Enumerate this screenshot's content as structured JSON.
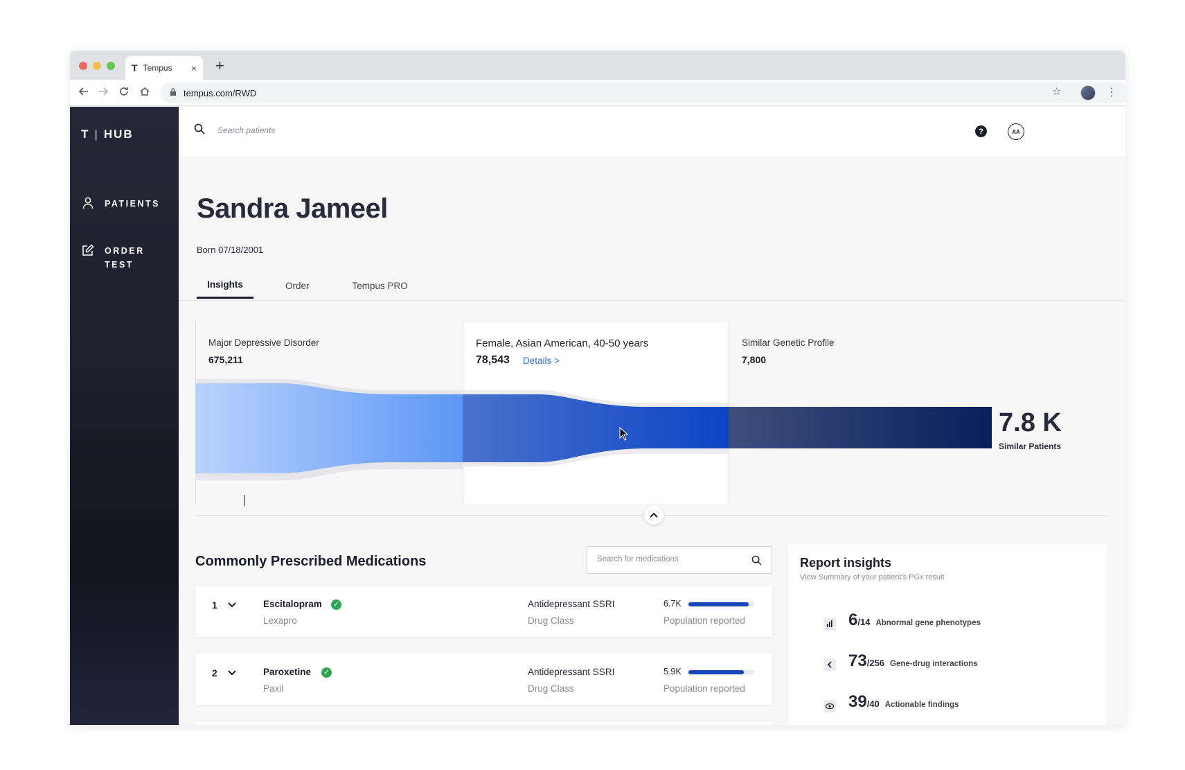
{
  "browser": {
    "tab_title": "Tempus",
    "tab_favicon": "T",
    "tab_close": "×",
    "new_tab": "+",
    "url": "tempus.com/RWD",
    "nav_icons": [
      "back-arrow-icon",
      "forward-arrow-icon",
      "reload-icon",
      "home-icon"
    ]
  },
  "sidebar": {
    "logo_left": "T",
    "logo_sep": "|",
    "logo_right": "HUB",
    "items": [
      {
        "label": "PATIENTS",
        "icon": "user-icon"
      },
      {
        "label_line1": "ORDER",
        "label_line2": "TEST",
        "icon": "edit-icon"
      }
    ]
  },
  "topbar": {
    "search_placeholder": "Search patients",
    "help": "?",
    "user_initials": "AA"
  },
  "patient": {
    "name": "Sandra Jameel",
    "born_label": "Born",
    "born_date": "07/18/2001"
  },
  "tabs": [
    "Insights",
    "Order",
    "Tempus PRO"
  ],
  "funnel": {
    "stages": [
      {
        "label": "Major Depressive Disorder",
        "value": "675,211"
      },
      {
        "label": "Female, Asian American, 40-50 years",
        "value": "78,543",
        "link": "Details >"
      },
      {
        "label": "Similar Genetic Profile",
        "value": "7,800"
      }
    ],
    "result_value": "7.8 K",
    "result_label": "Similar Patients",
    "colors": {
      "stage1_start": "#b9d3fd",
      "stage1_end": "#5d97f4",
      "stage2_start": "#4a72cc",
      "stage2_end": "#0c45c4",
      "stage3_start": "#3d4f7c",
      "stage3_end": "#081f5c"
    }
  },
  "medications": {
    "title": "Commonly Prescribed Medications",
    "search_placeholder": "Search for  medications",
    "items": [
      {
        "rank": "1",
        "name": "Escitalopram",
        "brand": "Lexapro",
        "class": "Antidepressant SSRI",
        "class_label": "Drug Class",
        "pop": "6.7K",
        "pop_fraction": 0.92,
        "pop_label": "Population reported"
      },
      {
        "rank": "2",
        "name": "Paroxetine",
        "brand": "Paxil",
        "class": "Antidepressant SSRI",
        "class_label": "Drug Class",
        "pop": "5.9K",
        "pop_fraction": 0.84,
        "pop_label": "Population reported"
      }
    ]
  },
  "report": {
    "title": "Report insights",
    "subtitle": "View Summary of your patient's PGx result",
    "rows": [
      {
        "big": "6",
        "small": "/14",
        "label": "Abnormal gene phenotypes",
        "icon": "bar-chart-icon"
      },
      {
        "big": "73",
        "small": "/256",
        "label": "Gene-drug interactions",
        "icon": "interaction-icon"
      },
      {
        "big": "39",
        "small": "/40",
        "label": "Actionable findings",
        "icon": "eye-icon"
      }
    ]
  }
}
